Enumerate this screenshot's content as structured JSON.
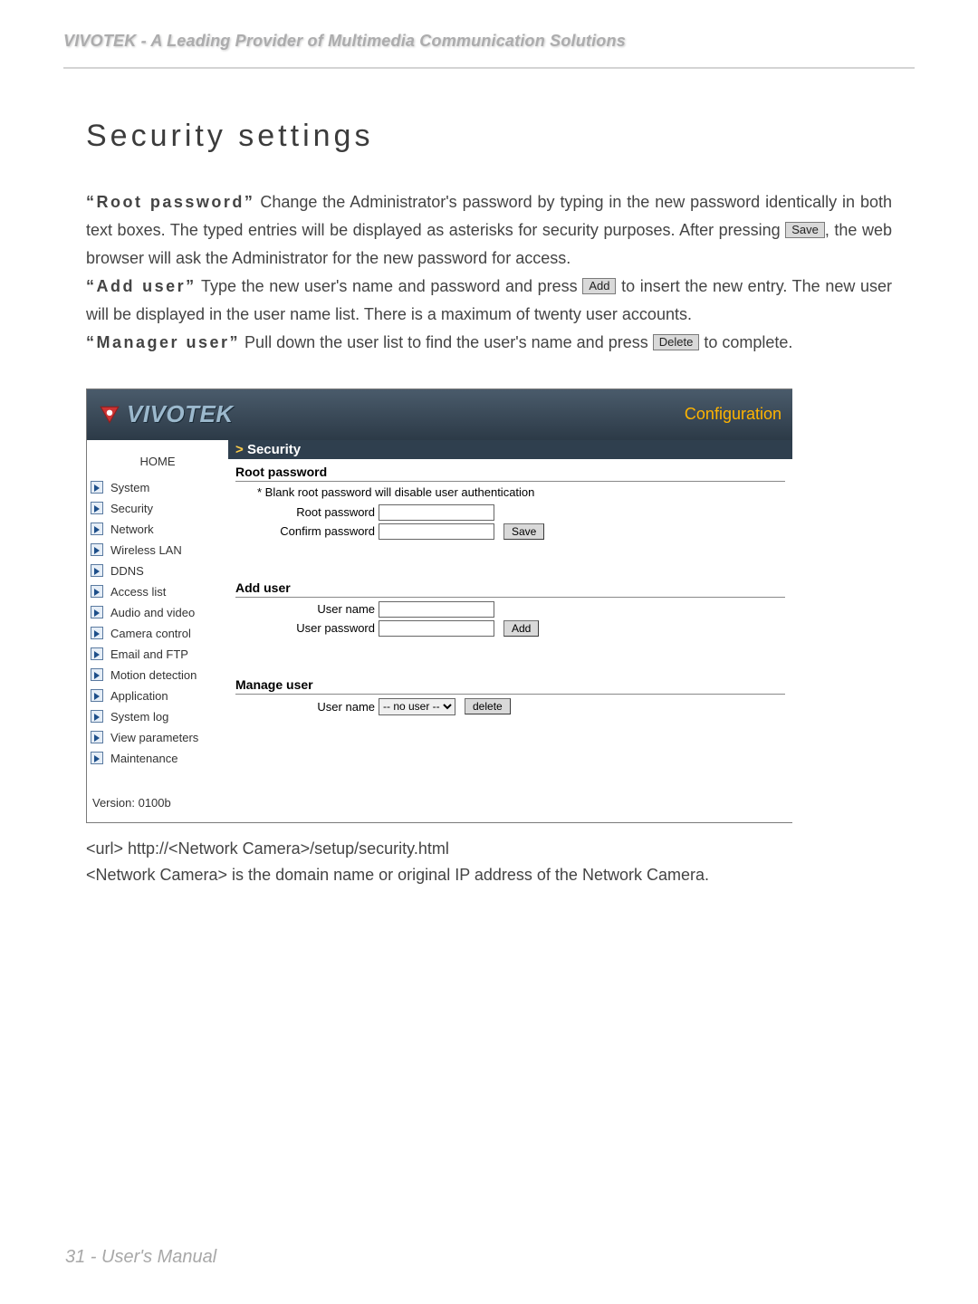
{
  "header": {
    "tagline": "VIVOTEK - A Leading Provider of Multimedia Communication Solutions"
  },
  "title": "Security settings",
  "paragraphs": {
    "p1a": "“Root password”",
    "p1b": " Change the Administrator's password by typing in the new password identically in both text boxes. The typed entries will be displayed as asterisks for security purposes. After pressing ",
    "p1c": ", the web browser will ask the Administrator for the new password for access.",
    "p2a": "“Add user”",
    "p2b": " Type the new user's name and password and press ",
    "p2c": " to insert the new entry. The new user will be displayed in the user name list. There is a maximum of twenty user accounts.",
    "p3a": "“Manager user”",
    "p3b": " Pull down the user list to find the user's name and press ",
    "p3c": " to complete."
  },
  "inline_buttons": {
    "save": "Save",
    "add": "Add",
    "delete": "Delete"
  },
  "ui": {
    "logo_text": "VIVOTEK",
    "config": "Configuration",
    "home": "HOME",
    "nav": [
      "System",
      "Security",
      "Network",
      "Wireless LAN",
      "DDNS",
      "Access list",
      "Audio and video",
      "Camera control",
      "Email and FTP",
      "Motion detection",
      "Application",
      "System log",
      "View parameters",
      "Maintenance"
    ],
    "version": "Version: 0100b",
    "breadcrumb": "Security",
    "root": {
      "heading": "Root password",
      "note": "* Blank root password will disable user authentication",
      "row1": "Root password",
      "row2": "Confirm password",
      "save": "Save"
    },
    "add": {
      "heading": "Add user",
      "row1": "User name",
      "row2": "User password",
      "btn": "Add"
    },
    "manage": {
      "heading": "Manage user",
      "row1": "User name",
      "select": "-- no user --",
      "btn": "delete"
    }
  },
  "below": {
    "l1": "<url> http://<Network Camera>/setup/security.html",
    "l2": "<Network Camera> is the domain name or original IP address of the Network Camera."
  },
  "footer": "31 - User's Manual"
}
